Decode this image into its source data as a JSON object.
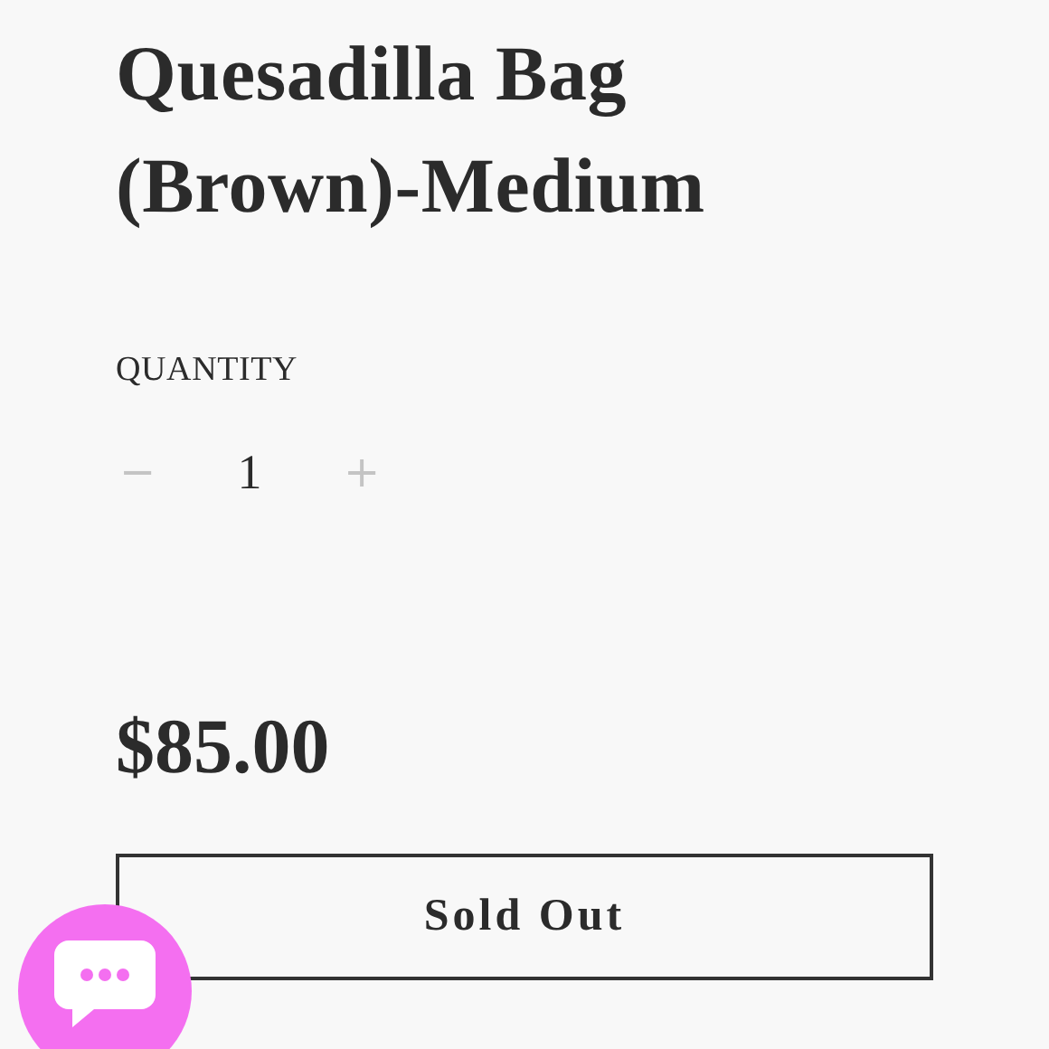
{
  "product": {
    "title": "Quesadilla Bag (Brown)-Medium",
    "quantity_label": "QUANTITY",
    "quantity": {
      "decrease": "−",
      "value": "1",
      "increase": "+"
    },
    "price": "$85.00",
    "button": {
      "label": "Sold Out"
    }
  },
  "chat": {
    "kind": "chat-launcher"
  }
}
